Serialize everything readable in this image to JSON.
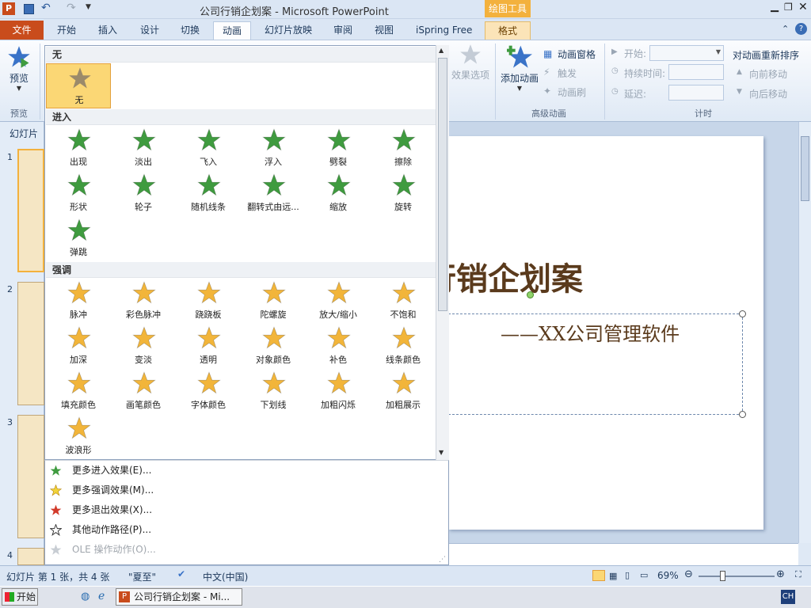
{
  "window": {
    "title": "公司行销企划案 - Microsoft PowerPoint",
    "context_group": "绘图工具"
  },
  "tabs": [
    {
      "label": "文件"
    },
    {
      "label": "开始"
    },
    {
      "label": "插入"
    },
    {
      "label": "设计"
    },
    {
      "label": "切换"
    },
    {
      "label": "动画"
    },
    {
      "label": "幻灯片放映"
    },
    {
      "label": "审阅"
    },
    {
      "label": "视图"
    },
    {
      "label": "iSpring Free"
    },
    {
      "label": "格式"
    }
  ],
  "ribbon": {
    "preview_label": "预览",
    "preview_group": "预览",
    "effect_options": "效果选项",
    "add_animation": "添加动画",
    "anim_pane": "动画窗格",
    "trigger": "触发",
    "anim_painter": "动画刷",
    "advanced_group": "高级动画",
    "start_label": "开始:",
    "duration_label": "持续时间:",
    "delay_label": "延迟:",
    "timing_group": "计时",
    "reorder_title": "对动画重新排序",
    "move_earlier": "向前移动",
    "move_later": "向后移动"
  },
  "gallery": {
    "none_section": "无",
    "none_item": "无",
    "entrance_section": "进入",
    "entrance": [
      "出现",
      "淡出",
      "飞入",
      "浮入",
      "劈裂",
      "擦除",
      "形状",
      "轮子",
      "随机线条",
      "翻转式由远...",
      "缩放",
      "旋转",
      "弹跳"
    ],
    "emphasis_section": "强调",
    "emphasis": [
      "脉冲",
      "彩色脉冲",
      "跷跷板",
      "陀螺旋",
      "放大/缩小",
      "不饱和",
      "加深",
      "变淡",
      "透明",
      "对象颜色",
      "补色",
      "线条颜色",
      "填充颜色",
      "画笔颜色",
      "字体颜色",
      "下划线",
      "加粗闪烁",
      "加粗展示",
      "波浪形"
    ]
  },
  "menu": [
    {
      "label": "更多进入效果(E)...",
      "enabled": true
    },
    {
      "label": "更多强调效果(M)...",
      "enabled": true
    },
    {
      "label": "更多退出效果(X)...",
      "enabled": true
    },
    {
      "label": "其他动作路径(P)...",
      "enabled": true
    },
    {
      "label": "OLE 操作动作(O)...",
      "enabled": false
    }
  ],
  "slides_panel": {
    "header": "幻灯片",
    "numbers": [
      "1",
      "2",
      "3",
      "4"
    ]
  },
  "slide": {
    "title": "行销企划案",
    "subtitle": "——XX公司管理软件"
  },
  "status": {
    "slide_info": "幻灯片 第 1 张，共 4 张",
    "theme": "\"夏至\"",
    "language": "中文(中国)",
    "zoom": "69%"
  },
  "taskbar": {
    "start": "开始",
    "window": "公司行销企划案 - Mi...",
    "ime": "CH"
  },
  "colors": {
    "file_tab": "#c94c1c",
    "entrance_star": "#3f9b3f",
    "emphasis_star": "#f2b53a",
    "title_text": "#5a3a1c"
  }
}
